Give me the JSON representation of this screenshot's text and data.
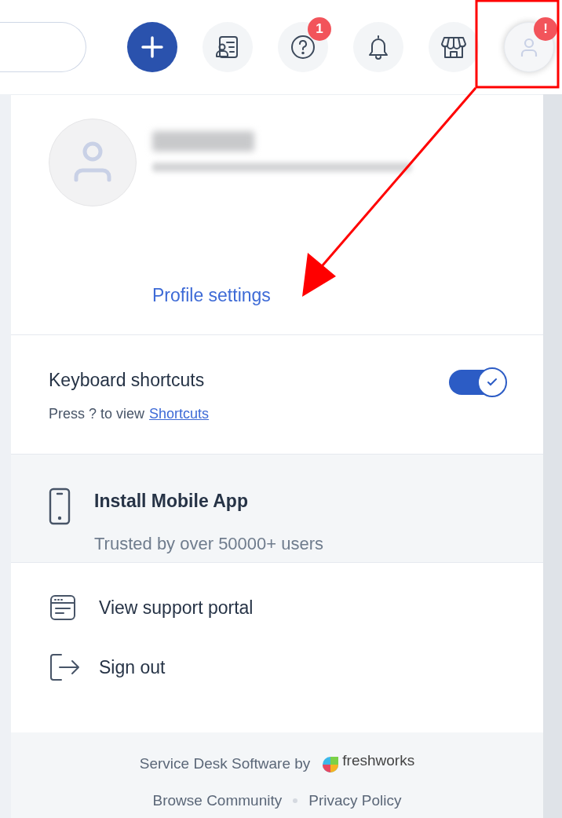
{
  "toolbar": {
    "buttons": [
      {
        "kind": "add",
        "selected": false
      },
      {
        "kind": "contacts",
        "selected": false
      },
      {
        "kind": "help",
        "badge": "1",
        "selected": false
      },
      {
        "kind": "notifications",
        "selected": false
      },
      {
        "kind": "store",
        "selected": false
      },
      {
        "kind": "profile",
        "badge": "!",
        "selected": true
      }
    ]
  },
  "profile": {
    "link": "Profile settings"
  },
  "keyboard": {
    "title": "Keyboard shortcuts",
    "hint": "Press ? to view",
    "link": "Shortcuts",
    "on": true
  },
  "mobile_app": {
    "title": "Install Mobile App",
    "subtitle": "Trusted by over 50000+ users"
  },
  "menu": [
    {
      "kind": "portal",
      "label": "View support portal"
    },
    {
      "kind": "signout",
      "label": "Sign out"
    }
  ],
  "footer": {
    "credit": "Service Desk Software by",
    "brand": "freshworks",
    "links": [
      "Browse Community",
      "Privacy Policy"
    ]
  }
}
